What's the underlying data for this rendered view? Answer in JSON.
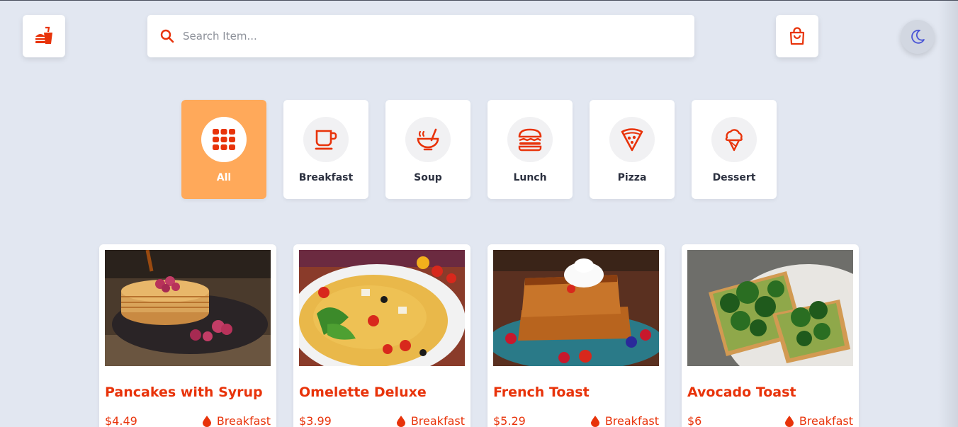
{
  "colors": {
    "accent": "#e8330a",
    "active_category": "#ffa95a",
    "background": "#e2e7f1",
    "theme_icon": "#4a55d6"
  },
  "header": {
    "logo_icon": "fastfood-icon",
    "search": {
      "placeholder": "Search Item..."
    },
    "cart_icon": "shopping-bag-icon",
    "theme_toggle_icon": "moon-icon"
  },
  "categories": [
    {
      "label": "All",
      "icon": "grid-icon",
      "active": true
    },
    {
      "label": "Breakfast",
      "icon": "coffee-cup-icon",
      "active": false
    },
    {
      "label": "Soup",
      "icon": "soup-bowl-icon",
      "active": false
    },
    {
      "label": "Lunch",
      "icon": "burger-icon",
      "active": false
    },
    {
      "label": "Pizza",
      "icon": "pizza-slice-icon",
      "active": false
    },
    {
      "label": "Dessert",
      "icon": "ice-cream-icon",
      "active": false
    }
  ],
  "items": [
    {
      "title": "Pancakes with Syrup",
      "price": "$4.49",
      "category": "Breakfast"
    },
    {
      "title": "Omelette Deluxe",
      "price": "$3.99",
      "category": "Breakfast"
    },
    {
      "title": "French Toast",
      "price": "$5.29",
      "category": "Breakfast"
    },
    {
      "title": "Avocado Toast",
      "price": "$6",
      "category": "Breakfast"
    }
  ]
}
